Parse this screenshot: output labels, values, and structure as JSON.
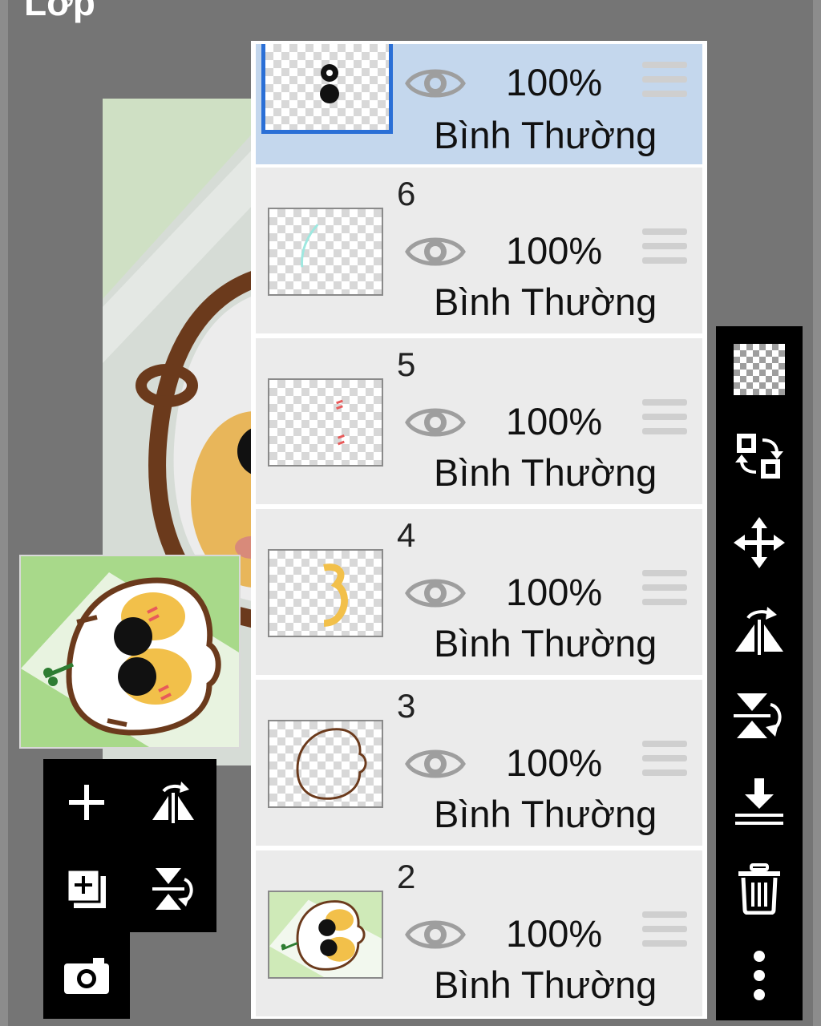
{
  "screen": {
    "title": "Lớp"
  },
  "layers": [
    {
      "number": "",
      "opacity": "100%",
      "blend": "Bình Thường",
      "selected": true
    },
    {
      "number": "6",
      "opacity": "100%",
      "blend": "Bình Thường",
      "selected": false
    },
    {
      "number": "5",
      "opacity": "100%",
      "blend": "Bình Thường",
      "selected": false
    },
    {
      "number": "4",
      "opacity": "100%",
      "blend": "Bình Thường",
      "selected": false
    },
    {
      "number": "3",
      "opacity": "100%",
      "blend": "Bình Thường",
      "selected": false
    },
    {
      "number": "2",
      "opacity": "100%",
      "blend": "Bình Thường",
      "selected": false
    }
  ],
  "left_toolbar": [
    {
      "icon": "plus-icon",
      "label": "add-layer"
    },
    {
      "icon": "flip-horizontal-icon",
      "label": "flip-horizontal"
    },
    {
      "icon": "duplicate-layer-icon",
      "label": "add-copy-layer"
    },
    {
      "icon": "flip-vertical-icon",
      "label": "flip-vertical"
    },
    {
      "icon": "camera-icon",
      "label": "import-photo"
    }
  ],
  "right_toolbar": [
    {
      "icon": "transparency-icon"
    },
    {
      "icon": "swap-layers-icon"
    },
    {
      "icon": "move-icon"
    },
    {
      "icon": "flip-horizontal-icon"
    },
    {
      "icon": "flip-vertical-icon"
    },
    {
      "icon": "merge-down-icon"
    },
    {
      "icon": "trash-icon"
    },
    {
      "icon": "more-vertical-icon"
    }
  ],
  "colors": {
    "selected_row": "#c4d7ed",
    "row": "#ebebeb",
    "selection_border": "#2a6fd6",
    "background": "#757575",
    "toolbar": "#000000"
  }
}
